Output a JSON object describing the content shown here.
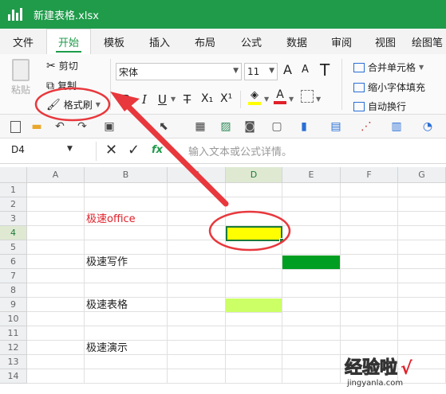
{
  "titlebar": {
    "title": "新建表格.xlsx",
    "color": "#1f9b4a"
  },
  "tabs": [
    {
      "label": "文件"
    },
    {
      "label": "开始",
      "active": true
    },
    {
      "label": "模板"
    },
    {
      "label": "插入"
    },
    {
      "label": "布局"
    },
    {
      "label": "公式"
    },
    {
      "label": "数据"
    },
    {
      "label": "审阅"
    },
    {
      "label": "视图"
    },
    {
      "label": "绘图笔"
    }
  ],
  "ribbon": {
    "paste": "粘贴",
    "cut": "剪切",
    "copy": "复制",
    "format_painter": "格式刷",
    "font_name": "宋体",
    "font_size": "11",
    "bold": "B",
    "italic": "I",
    "underline": "U",
    "strike": "T",
    "subscript": "X₁",
    "superscript": "X¹",
    "merge": "合并单元格",
    "shrink": "缩小字体填充",
    "wrap": "自动换行"
  },
  "formula": {
    "cell_ref": "D4",
    "fx": "fx",
    "placeholder": "输入文本或公式详情。"
  },
  "columns": [
    "A",
    "B",
    "C",
    "D",
    "E",
    "F",
    "G"
  ],
  "rows": [
    "1",
    "2",
    "3",
    "4",
    "5",
    "6",
    "7",
    "8",
    "9",
    "10",
    "11",
    "12",
    "13",
    "14"
  ],
  "cells": {
    "b3": "极速office",
    "b6": "极速写作",
    "b9": "极速表格",
    "b12": "极速演示"
  },
  "colors": {
    "yellow": "#ffff00",
    "green": "#009e22",
    "light_green": "#ccff66",
    "red_text": "#e0202a",
    "annotation": "#e8383d"
  },
  "watermark": {
    "text": "经验啦",
    "check": "√",
    "url": "jingyanla.com"
  }
}
